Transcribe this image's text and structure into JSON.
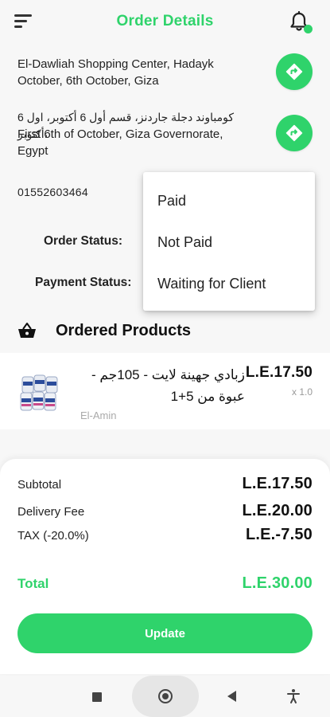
{
  "header": {
    "title": "Order Details",
    "menu_icon": "menu-icon",
    "bell_icon": "notification-bell-icon"
  },
  "addresses": [
    {
      "text": "El-Dawliah Shopping Center, Hadayk October, 6th October, Giza",
      "icon": "directions-icon"
    },
    {
      "text_ar": "كومباوند دجلة جاردنز، قسم أول 6 أكتوبر، اول 6 أكتوبر،",
      "text": "First 6th of October, Giza Governorate, Egypt",
      "icon": "directions-icon"
    }
  ],
  "phone": "01552603464",
  "order_status_label": "Order Status:",
  "payment_status_label": "Payment Status:",
  "dropdown": {
    "options": [
      "Paid",
      "Not Paid",
      "Waiting for Client"
    ]
  },
  "products_section": {
    "title": "Ordered Products",
    "icon": "basket-icon"
  },
  "products": [
    {
      "name": "زبادي جهينة لايت - 105جم - عبوة من 5+1",
      "store": "El-Amin",
      "price": "L.E.17.50",
      "qty": "x 1.0"
    }
  ],
  "summary": {
    "subtotal_label": "Subtotal",
    "subtotal_value": "L.E.17.50",
    "delivery_label": "Delivery Fee",
    "delivery_value": "L.E.20.00",
    "tax_label": "TAX (-20.0%)",
    "tax_value": "L.E.-7.50",
    "total_label": "Total",
    "total_value": "L.E.30.00",
    "update_label": "Update"
  },
  "colors": {
    "accent": "#2fd36b",
    "text": "#222222",
    "muted": "#aaaaaa"
  }
}
